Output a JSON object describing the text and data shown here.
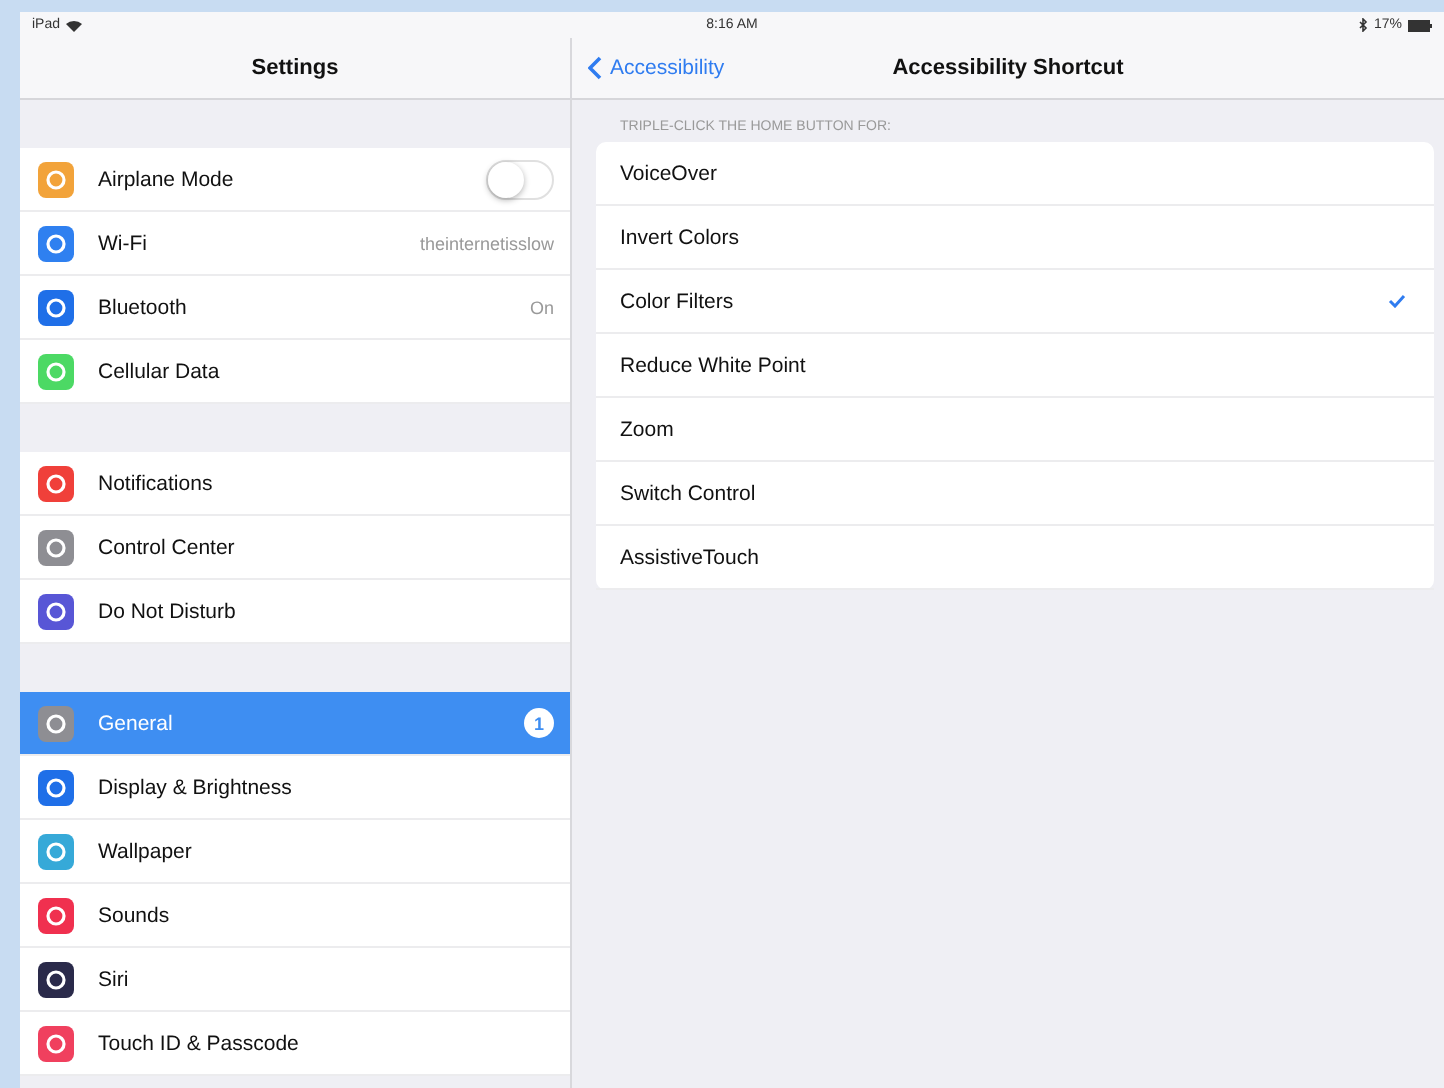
{
  "status_bar": {
    "carrier": "iPad",
    "time": "8:16 AM",
    "battery": "17%"
  },
  "sidebar": {
    "title": "Settings",
    "groups": [
      [
        {
          "label": "Airplane Mode",
          "color": "#f2a33a",
          "kind": "toggle",
          "on": false
        },
        {
          "label": "Wi-Fi",
          "color": "#2f80f0",
          "kind": "value",
          "value": "theinternetisslow"
        },
        {
          "label": "Bluetooth",
          "color": "#1f6fe8",
          "kind": "value",
          "value": "On"
        },
        {
          "label": "Cellular Data",
          "color": "#4cd964",
          "kind": "plain"
        }
      ],
      [
        {
          "label": "Notifications",
          "color": "#f0403a",
          "kind": "plain"
        },
        {
          "label": "Control Center",
          "color": "#8e8e93",
          "kind": "plain"
        },
        {
          "label": "Do Not Disturb",
          "color": "#5856d6",
          "kind": "plain"
        }
      ],
      [
        {
          "label": "General",
          "color": "#8e8e93",
          "kind": "badge",
          "badge": "1",
          "selected": true
        },
        {
          "label": "Display & Brightness",
          "color": "#1f6fe8",
          "kind": "plain",
          "selected": false
        },
        {
          "label": "Wallpaper",
          "color": "#36a9d8",
          "kind": "plain",
          "selected": false
        },
        {
          "label": "Sounds",
          "color": "#f0304f",
          "kind": "plain",
          "selected": false
        },
        {
          "label": "Siri",
          "color": "#2a2a4a",
          "kind": "plain",
          "selected": false
        },
        {
          "label": "Touch ID & Passcode",
          "color": "#f0405e",
          "kind": "plain",
          "selected": false
        }
      ]
    ]
  },
  "detail": {
    "back": "Accessibility",
    "title": "Accessibility Shortcut",
    "section_header": "TRIPLE-CLICK THE HOME BUTTON FOR:",
    "options": [
      {
        "label": "VoiceOver",
        "checked": false
      },
      {
        "label": "Invert Colors",
        "checked": false
      },
      {
        "label": "Color Filters",
        "checked": true
      },
      {
        "label": "Reduce White Point",
        "checked": false
      },
      {
        "label": "Zoom",
        "checked": false
      },
      {
        "label": "Switch Control",
        "checked": false
      },
      {
        "label": "AssistiveTouch",
        "checked": false
      }
    ]
  }
}
